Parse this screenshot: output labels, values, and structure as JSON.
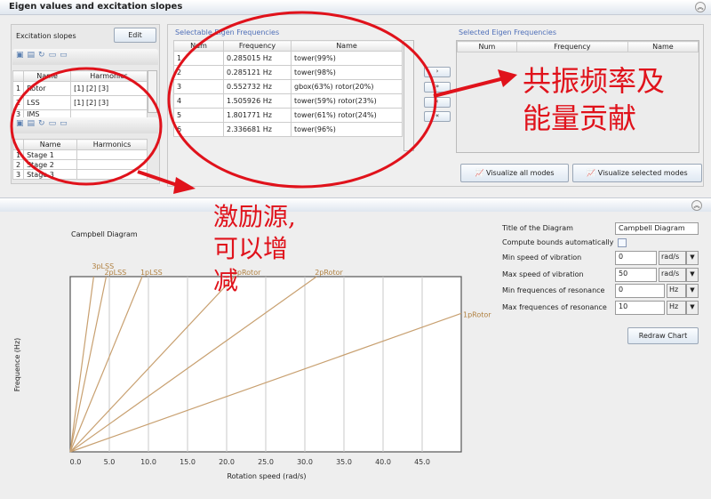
{
  "top_panel": {
    "title": "Eigen values and excitation slopes",
    "excitation": {
      "label": "Excitation slopes",
      "edit_button": "Edit",
      "table1": {
        "headers": [
          "Name",
          "Harmonics"
        ],
        "rows": [
          [
            "1",
            "Rotor",
            "[1]  [2]  [3]"
          ],
          [
            "2",
            "LSS",
            "[1]  [2]  [3]"
          ],
          [
            "3",
            "IMS",
            ""
          ]
        ]
      },
      "table2": {
        "headers": [
          "Name",
          "Harmonics"
        ],
        "rows": [
          [
            "1",
            "Stage 1",
            ""
          ],
          [
            "2",
            "Stage 2",
            ""
          ],
          [
            "3",
            "Stage 3",
            ""
          ]
        ]
      }
    },
    "selectable": {
      "title": "Selectable Eigen Frequencies",
      "headers": [
        "Num",
        "Frequency",
        "Name"
      ],
      "rows": [
        [
          "1",
          "0.285015 Hz",
          "tower(99%)"
        ],
        [
          "2",
          "0.285121 Hz",
          "tower(98%)"
        ],
        [
          "3",
          "0.552732 Hz",
          "gbox(63%) rotor(20%)"
        ],
        [
          "4",
          "1.505926 Hz",
          "tower(59%) rotor(23%)"
        ],
        [
          "5",
          "1.801771 Hz",
          "tower(61%) rotor(24%)"
        ],
        [
          "6",
          "2.336681 Hz",
          "tower(96%)"
        ]
      ]
    },
    "move_buttons": [
      "›",
      "»",
      "‹",
      "«"
    ],
    "selected": {
      "title": "Selected Eigen Frequencies",
      "headers": [
        "Num",
        "Frequency",
        "Name"
      ]
    },
    "visualize_all": "Visualize all modes",
    "visualize_selected": "Visualize selected modes"
  },
  "annotations": {
    "resonance_note": "共振频率及能量贡献",
    "resonance_line1": "共振频率及",
    "resonance_line2": "能量贡献",
    "excitation_note_line1": "激励源,",
    "excitation_note_line2": "可以增",
    "excitation_note_line3": "减",
    "color": "#e0121b"
  },
  "settings": {
    "title_label": "Title of the Diagram",
    "title_value": "Campbell Diagram",
    "compute_label": "Compute bounds automatically",
    "compute_checked": false,
    "rows": [
      {
        "label": "Min speed of vibration",
        "value": "0",
        "unit": "rad/s"
      },
      {
        "label": "Max speed of vibration",
        "value": "50",
        "unit": "rad/s"
      },
      {
        "label": "Min frequences of resonance",
        "value": "0",
        "unit": "Hz"
      },
      {
        "label": "Max frequences of resonance",
        "value": "10",
        "unit": "Hz"
      }
    ],
    "redraw": "Redraw Chart"
  },
  "chart_data": {
    "type": "line",
    "title": "Campbell Diagram",
    "xlabel": "Rotation speed (rad/s)",
    "ylabel": "Frequence (Hz)",
    "xlim": [
      0,
      50
    ],
    "ylim": [
      0,
      10
    ],
    "xticks": [
      "0.0",
      "5.0",
      "10.0",
      "15.0",
      "20.0",
      "25.0",
      "30.0",
      "35.0",
      "40.0",
      "45.0"
    ],
    "grid": "vertical",
    "line_color": "#c8a070",
    "series": [
      {
        "name": "3pLSS",
        "points": [
          [
            0,
            0
          ],
          [
            3.0,
            10
          ]
        ]
      },
      {
        "name": "2pLSS",
        "points": [
          [
            0,
            0
          ],
          [
            4.6,
            10
          ]
        ]
      },
      {
        "name": "1pLSS",
        "points": [
          [
            0,
            0
          ],
          [
            9.2,
            10
          ]
        ]
      },
      {
        "name": "3pRotor",
        "points": [
          [
            0,
            0
          ],
          [
            21,
            10
          ]
        ]
      },
      {
        "name": "2pRotor",
        "points": [
          [
            0,
            0
          ],
          [
            31.5,
            10
          ]
        ]
      },
      {
        "name": "1pRotor",
        "points": [
          [
            0,
            0
          ],
          [
            50,
            7.9
          ]
        ]
      }
    ]
  }
}
